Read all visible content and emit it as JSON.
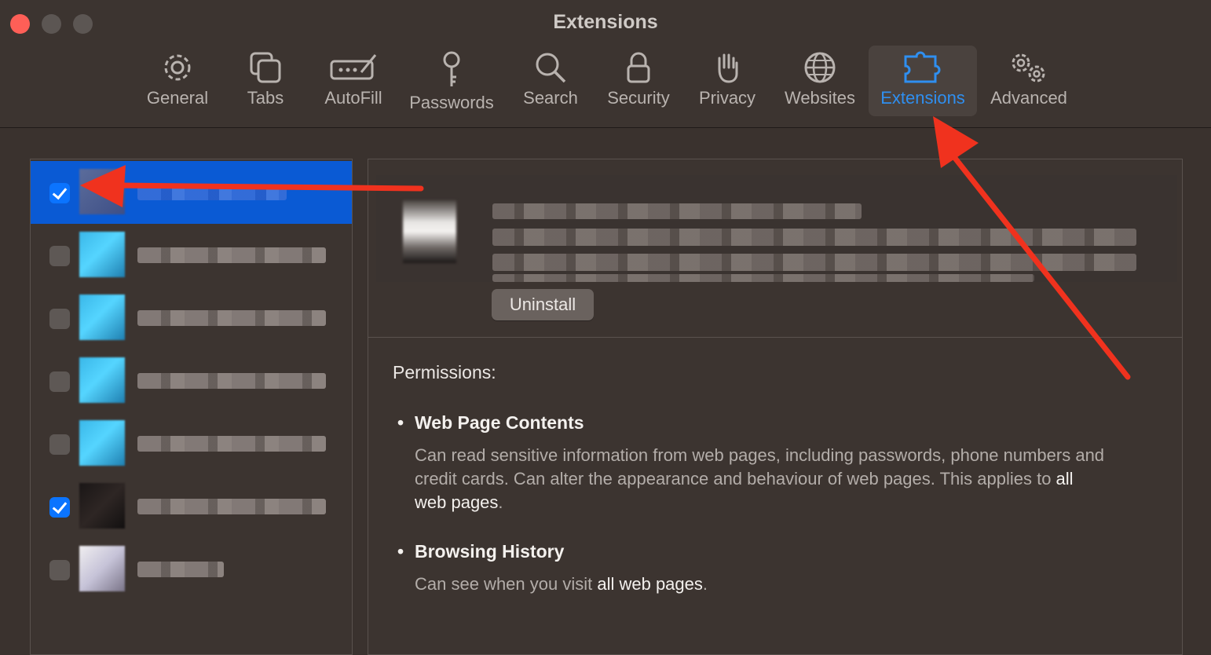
{
  "window": {
    "title": "Extensions"
  },
  "toolbar": {
    "items": [
      {
        "label": "General",
        "icon": "gear-icon"
      },
      {
        "label": "Tabs",
        "icon": "tabs-icon"
      },
      {
        "label": "AutoFill",
        "icon": "autofill-icon"
      },
      {
        "label": "Passwords",
        "icon": "key-icon"
      },
      {
        "label": "Search",
        "icon": "magnifier-icon"
      },
      {
        "label": "Security",
        "icon": "lock-icon"
      },
      {
        "label": "Privacy",
        "icon": "hand-icon"
      },
      {
        "label": "Websites",
        "icon": "globe-icon"
      },
      {
        "label": "Extensions",
        "icon": "puzzle-icon",
        "active": true
      },
      {
        "label": "Advanced",
        "icon": "gears-icon"
      }
    ],
    "accent": "#2f8ff0"
  },
  "extensions_list": {
    "rows": [
      {
        "checked": true,
        "selected": true
      },
      {
        "checked": false
      },
      {
        "checked": false
      },
      {
        "checked": false
      },
      {
        "checked": false
      },
      {
        "checked": true
      },
      {
        "checked": false
      }
    ]
  },
  "detail": {
    "uninstall_label": "Uninstall",
    "permissions_title": "Permissions:",
    "permissions": [
      {
        "name": "Web Page Contents",
        "desc_before": "Can read sensitive information from web pages, including passwords, phone numbers and credit cards. Can alter the appearance and behaviour of web pages. This applies to ",
        "desc_emphasis": "all web pages",
        "desc_after": "."
      },
      {
        "name": "Browsing History",
        "desc_before": "Can see when you visit ",
        "desc_emphasis": "all web pages",
        "desc_after": "."
      }
    ]
  },
  "annotation_color": "#f0321e"
}
